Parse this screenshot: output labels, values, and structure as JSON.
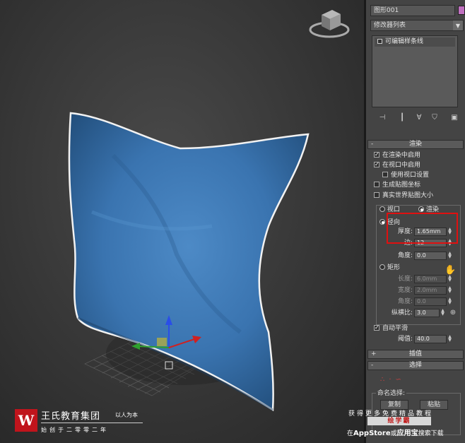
{
  "panel": {
    "object_name": "图形001",
    "modifier_list": "修改器列表",
    "stack_item": "可编辑样条线"
  },
  "render_rollout": {
    "title": "渲染",
    "enable_in_renderer": "在渲染中启用",
    "enable_in_viewport": "在视口中启用",
    "use_viewport_settings": "使用视口设置",
    "generate_mapping": "生成贴图坐标",
    "real_world_map_size": "真实世界贴图大小",
    "viewport_option": "视口",
    "renderer_option": "渲染",
    "radial_label": "径向",
    "thickness_label": "厚度:",
    "thickness_value": "1.65mm",
    "sides_label": "边:",
    "sides_value": "12",
    "angle_label": "角度:",
    "angle_value": "0.0",
    "rectangular_label": "矩形",
    "length_label": "长度:",
    "length_value": "6.0mm",
    "width_label": "宽度:",
    "width_value": "2.0mm",
    "rect_angle_label": "角度:",
    "rect_angle_value": "0.0",
    "aspect_label": "纵横比:",
    "aspect_value": "3.0",
    "auto_smooth": "自动平滑",
    "threshold_label": "阈值:",
    "threshold_value": "40.0"
  },
  "interpolation_rollout": {
    "title": "插值"
  },
  "selection_rollout": {
    "title": "选择",
    "named_selections": "命名选择:",
    "copy_button": "复制",
    "paste_button": "粘贴"
  },
  "watermark": {
    "logo_letter": "W",
    "company": "王氏教育集团",
    "slogan": "以人为本",
    "since": "始创于二零零二年",
    "promo_line1": "获得更多免费精品教程",
    "promo_brand": "绘学霸",
    "promo_line3_pre": "在",
    "promo_appstore": "AppStore",
    "promo_or": "或",
    "promo_yyb": "应用宝",
    "promo_line3_post": "搜索下载"
  },
  "colors": {
    "pillow": "#3d7ab8",
    "highlight_box": "#e01010",
    "swatch": "#c070c0",
    "logo": "#c0141c"
  }
}
